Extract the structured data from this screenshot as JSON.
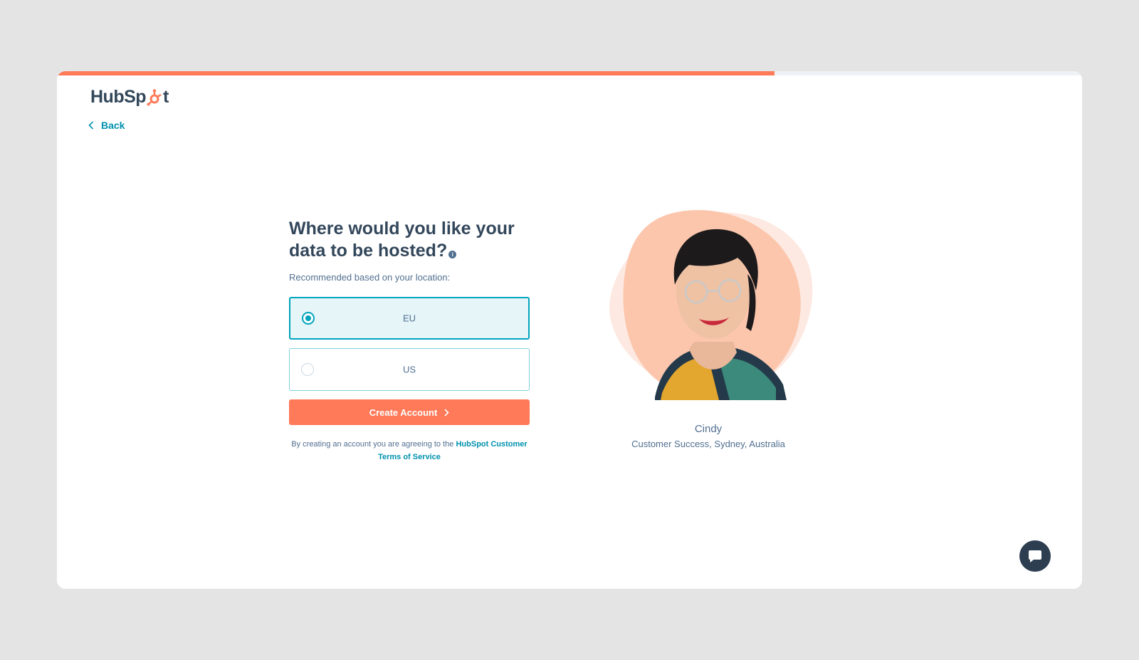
{
  "progress": {
    "fraction": 0.7
  },
  "brand": {
    "name_start": "HubSp",
    "name_end": "t",
    "accent": "#ff7a59",
    "link": "#0091ae"
  },
  "nav": {
    "back_label": "Back"
  },
  "form": {
    "heading": "Where would you like your data to be hosted?",
    "subtitle": "Recommended based on your location:",
    "options": [
      {
        "label": "EU",
        "selected": true
      },
      {
        "label": "US",
        "selected": false
      }
    ],
    "submit_label": "Create Account",
    "terms_prefix": "By creating an account you are agreeing to the",
    "terms_link": "HubSpot Customer Terms of Service"
  },
  "testimonial": {
    "name": "Cindy",
    "role": "Customer Success, Sydney, Australia"
  },
  "chat": {
    "icon": "chat-bubble-icon"
  }
}
